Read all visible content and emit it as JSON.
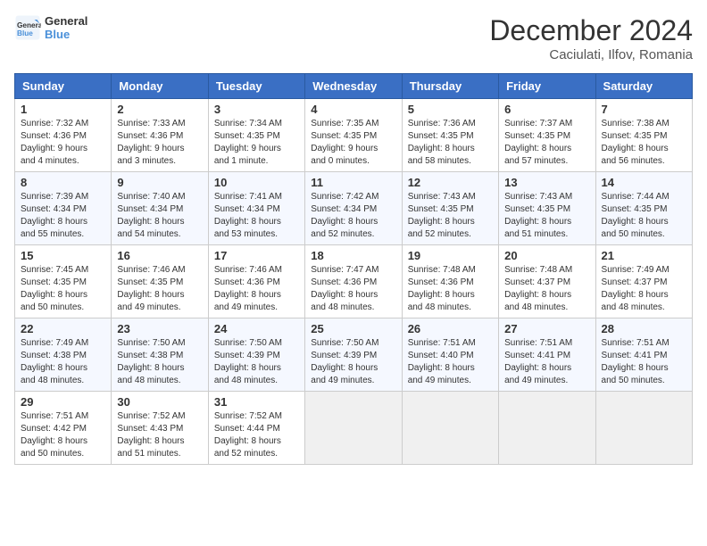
{
  "logo": {
    "text_general": "General",
    "text_blue": "Blue"
  },
  "title": "December 2024",
  "subtitle": "Caciulati, Ilfov, Romania",
  "weekdays": [
    "Sunday",
    "Monday",
    "Tuesday",
    "Wednesday",
    "Thursday",
    "Friday",
    "Saturday"
  ],
  "weeks": [
    [
      {
        "day": "1",
        "info": "Sunrise: 7:32 AM\nSunset: 4:36 PM\nDaylight: 9 hours\nand 4 minutes."
      },
      {
        "day": "2",
        "info": "Sunrise: 7:33 AM\nSunset: 4:36 PM\nDaylight: 9 hours\nand 3 minutes."
      },
      {
        "day": "3",
        "info": "Sunrise: 7:34 AM\nSunset: 4:35 PM\nDaylight: 9 hours\nand 1 minute."
      },
      {
        "day": "4",
        "info": "Sunrise: 7:35 AM\nSunset: 4:35 PM\nDaylight: 9 hours\nand 0 minutes."
      },
      {
        "day": "5",
        "info": "Sunrise: 7:36 AM\nSunset: 4:35 PM\nDaylight: 8 hours\nand 58 minutes."
      },
      {
        "day": "6",
        "info": "Sunrise: 7:37 AM\nSunset: 4:35 PM\nDaylight: 8 hours\nand 57 minutes."
      },
      {
        "day": "7",
        "info": "Sunrise: 7:38 AM\nSunset: 4:35 PM\nDaylight: 8 hours\nand 56 minutes."
      }
    ],
    [
      {
        "day": "8",
        "info": "Sunrise: 7:39 AM\nSunset: 4:34 PM\nDaylight: 8 hours\nand 55 minutes."
      },
      {
        "day": "9",
        "info": "Sunrise: 7:40 AM\nSunset: 4:34 PM\nDaylight: 8 hours\nand 54 minutes."
      },
      {
        "day": "10",
        "info": "Sunrise: 7:41 AM\nSunset: 4:34 PM\nDaylight: 8 hours\nand 53 minutes."
      },
      {
        "day": "11",
        "info": "Sunrise: 7:42 AM\nSunset: 4:34 PM\nDaylight: 8 hours\nand 52 minutes."
      },
      {
        "day": "12",
        "info": "Sunrise: 7:43 AM\nSunset: 4:35 PM\nDaylight: 8 hours\nand 52 minutes."
      },
      {
        "day": "13",
        "info": "Sunrise: 7:43 AM\nSunset: 4:35 PM\nDaylight: 8 hours\nand 51 minutes."
      },
      {
        "day": "14",
        "info": "Sunrise: 7:44 AM\nSunset: 4:35 PM\nDaylight: 8 hours\nand 50 minutes."
      }
    ],
    [
      {
        "day": "15",
        "info": "Sunrise: 7:45 AM\nSunset: 4:35 PM\nDaylight: 8 hours\nand 50 minutes."
      },
      {
        "day": "16",
        "info": "Sunrise: 7:46 AM\nSunset: 4:35 PM\nDaylight: 8 hours\nand 49 minutes."
      },
      {
        "day": "17",
        "info": "Sunrise: 7:46 AM\nSunset: 4:36 PM\nDaylight: 8 hours\nand 49 minutes."
      },
      {
        "day": "18",
        "info": "Sunrise: 7:47 AM\nSunset: 4:36 PM\nDaylight: 8 hours\nand 48 minutes."
      },
      {
        "day": "19",
        "info": "Sunrise: 7:48 AM\nSunset: 4:36 PM\nDaylight: 8 hours\nand 48 minutes."
      },
      {
        "day": "20",
        "info": "Sunrise: 7:48 AM\nSunset: 4:37 PM\nDaylight: 8 hours\nand 48 minutes."
      },
      {
        "day": "21",
        "info": "Sunrise: 7:49 AM\nSunset: 4:37 PM\nDaylight: 8 hours\nand 48 minutes."
      }
    ],
    [
      {
        "day": "22",
        "info": "Sunrise: 7:49 AM\nSunset: 4:38 PM\nDaylight: 8 hours\nand 48 minutes."
      },
      {
        "day": "23",
        "info": "Sunrise: 7:50 AM\nSunset: 4:38 PM\nDaylight: 8 hours\nand 48 minutes."
      },
      {
        "day": "24",
        "info": "Sunrise: 7:50 AM\nSunset: 4:39 PM\nDaylight: 8 hours\nand 48 minutes."
      },
      {
        "day": "25",
        "info": "Sunrise: 7:50 AM\nSunset: 4:39 PM\nDaylight: 8 hours\nand 49 minutes."
      },
      {
        "day": "26",
        "info": "Sunrise: 7:51 AM\nSunset: 4:40 PM\nDaylight: 8 hours\nand 49 minutes."
      },
      {
        "day": "27",
        "info": "Sunrise: 7:51 AM\nSunset: 4:41 PM\nDaylight: 8 hours\nand 49 minutes."
      },
      {
        "day": "28",
        "info": "Sunrise: 7:51 AM\nSunset: 4:41 PM\nDaylight: 8 hours\nand 50 minutes."
      }
    ],
    [
      {
        "day": "29",
        "info": "Sunrise: 7:51 AM\nSunset: 4:42 PM\nDaylight: 8 hours\nand 50 minutes."
      },
      {
        "day": "30",
        "info": "Sunrise: 7:52 AM\nSunset: 4:43 PM\nDaylight: 8 hours\nand 51 minutes."
      },
      {
        "day": "31",
        "info": "Sunrise: 7:52 AM\nSunset: 4:44 PM\nDaylight: 8 hours\nand 52 minutes."
      },
      {
        "day": "",
        "info": ""
      },
      {
        "day": "",
        "info": ""
      },
      {
        "day": "",
        "info": ""
      },
      {
        "day": "",
        "info": ""
      }
    ]
  ]
}
